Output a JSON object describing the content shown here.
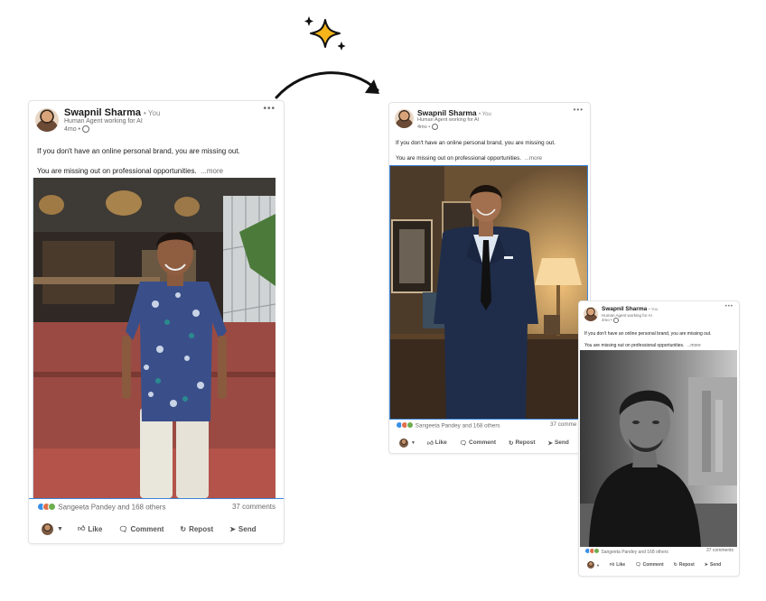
{
  "posts": [
    {
      "author_name": "Swapnil Sharma",
      "you_label": "• You",
      "headline": "Human Agent working for AI",
      "time": "4mo •",
      "line1": "If you don't have an online personal brand, you are missing out.",
      "line2": "You are missing out on professional opportunities.",
      "more_label": "...more",
      "reactions_text": "Sangeeta Pandey and 168 others",
      "comments_text": "37 comments",
      "actions": {
        "like": "Like",
        "comment": "Comment",
        "repost": "Repost",
        "send": "Send"
      }
    },
    {
      "author_name": "Swapnil Sharma",
      "you_label": "• You",
      "headline": "Human Agent working for AI",
      "time": "4mo •",
      "line1": "If you don't have an online personal brand, you are missing out.",
      "line2": "You are missing out on professional opportunities.",
      "more_label": "...more",
      "reactions_text": "Sangeeta Pandey and 168 others",
      "comments_text": "37 comme",
      "actions": {
        "like": "Like",
        "comment": "Comment",
        "repost": "Repost",
        "send": "Send"
      }
    },
    {
      "author_name": "Swapnil Sharma",
      "you_label": "• You",
      "headline": "Human Agent working for AI",
      "time": "4mo •",
      "line1": "If you don't have an online personal brand, you are missing out.",
      "line2": "You are missing out on professional opportunities.",
      "more_label": "...more",
      "reactions_text": "Sangeeta Pandey and 168 others",
      "comments_text": "37 comments",
      "actions": {
        "like": "Like",
        "comment": "Comment",
        "repost": "Repost",
        "send": "Send"
      }
    }
  ],
  "icons": {
    "sparkle": "sparkle-icon",
    "arrow": "curved-arrow-icon"
  },
  "colors": {
    "sparkle_fill": "#f5b41a",
    "highlight_border": "#3b86d6",
    "reaction_like": "#378fe9",
    "reaction_celebrate": "#df704d",
    "reaction_support": "#6dae4f"
  }
}
